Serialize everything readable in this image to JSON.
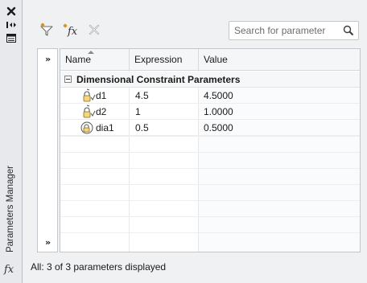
{
  "palette": {
    "parameter_icon_accent": "#c8a23a",
    "delete_icon_gray": "#a8a8a8"
  },
  "side_strip": {
    "title": "Parameters Manager",
    "close_icon": "close-icon",
    "autohide_icon": "auto-hide-icon",
    "properties_icon": "properties-icon",
    "fx_label": "fx"
  },
  "toolbar": {
    "filter_icon": "create-filter-icon",
    "new_param_icon": "new-user-parameter-icon",
    "new_param_label": "fx",
    "delete_icon": "delete-parameter-icon",
    "search": {
      "placeholder": "Search for parameter",
      "icon": "magnifier-icon"
    }
  },
  "filter_panel": {
    "expand_top_label": "»",
    "expand_bottom_label": "»"
  },
  "grid": {
    "columns": [
      {
        "label": "Name",
        "sorted": "ascending"
      },
      {
        "label": "Expression"
      },
      {
        "label": "Value"
      }
    ],
    "group": {
      "title": "Dimensional Constraint Parameters",
      "expanded": true
    },
    "rows": [
      {
        "icon": "dimensional-lock-icon",
        "name": "d1",
        "expression": "4.5",
        "value": "4.5000"
      },
      {
        "icon": "dimensional-lock-icon",
        "name": "d2",
        "expression": "1",
        "value": "1.0000"
      },
      {
        "icon": "diameter-lock-icon",
        "name": "dia1",
        "expression": "0.5",
        "value": "0.5000"
      }
    ]
  },
  "status": {
    "text": "All: 3 of 3 parameters displayed"
  }
}
